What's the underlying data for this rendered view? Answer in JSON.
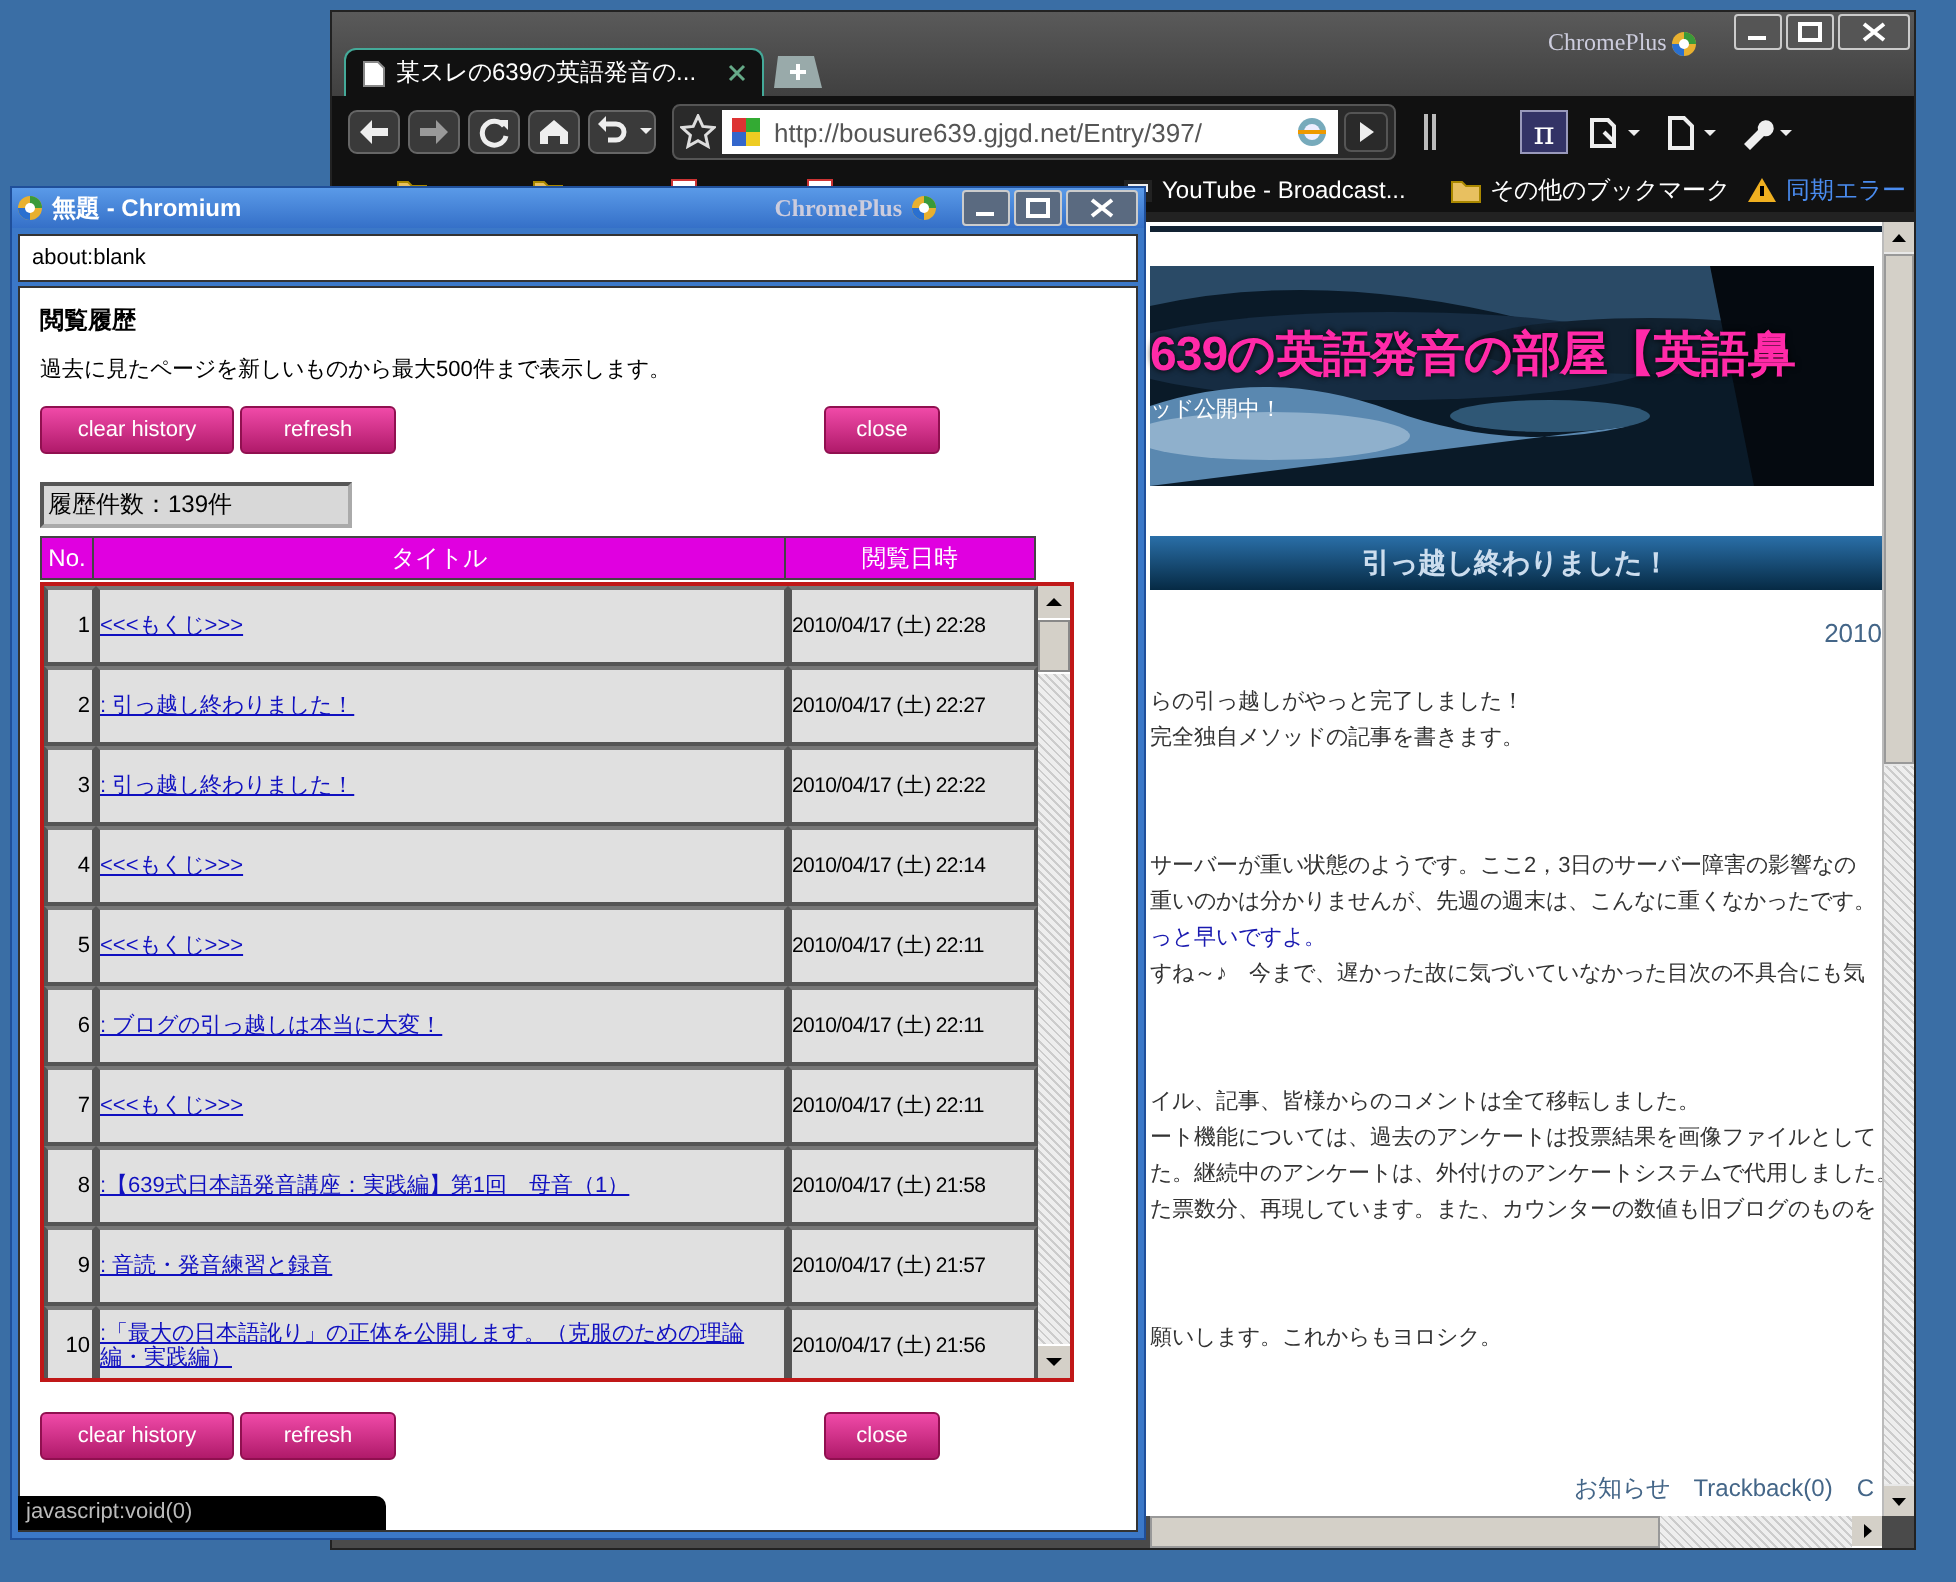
{
  "browser": {
    "tab_title": "某スレの639の英語発音の...",
    "brand": "ChromePlus",
    "address": "http://bousure639.gjgd.net/Entry/397/",
    "pi_button": "π",
    "bookmarks": [
      {
        "kind": "folder"
      },
      {
        "kind": "folder"
      },
      {
        "kind": "page"
      },
      {
        "kind": "page"
      },
      {
        "kind": "video",
        "label": "YouTube - Broadcast..."
      }
    ],
    "other_bookmarks": "その他のブックマーク",
    "sync_error": "同期エラー",
    "page": {
      "banner_title": "639の英語発音の部屋【英語鼻",
      "banner_subtitle": "ッド公開中！",
      "post_title": "引っ越し終わりました！",
      "date": "2010",
      "paragraphs": [
        [
          {
            "kind": "text",
            "text": "らの引っ越しがやっと完了しました！"
          },
          {
            "kind": "text",
            "text": "完全独自メソッドの記事を書きます。"
          }
        ],
        [
          {
            "kind": "text",
            "text": "サーバーが重い状態のようです。ここ2，3日のサーバー障害の影響なの"
          },
          {
            "kind": "text",
            "text": "重いのかは分かりませんが、先週の週末は、こんなに重くなかったです。"
          },
          {
            "kind": "link",
            "text": "っと早いですよ。"
          },
          {
            "kind": "text",
            "text": "すね～♪　今まで、遅かった故に気づいていなかった目次の不具合にも気"
          }
        ],
        [
          {
            "kind": "text",
            "text": "イル、記事、皆様からのコメントは全て移転しました。"
          },
          {
            "kind": "text",
            "text": "ート機能については、過去のアンケートは投票結果を画像ファイルとして"
          },
          {
            "kind": "text",
            "text": "た。継続中のアンケートは、外付けのアンケートシステムで代用しました。"
          },
          {
            "kind": "text",
            "text": "た票数分、再現しています。また、カウンターの数値も旧ブログのものを"
          }
        ],
        [
          {
            "kind": "text",
            "text": "願いします。これからもヨロシク。"
          }
        ]
      ],
      "footer": "お知らせ　Trackback(0)　C"
    }
  },
  "popup": {
    "title": "無題 - Chromium",
    "brand": "ChromePlus",
    "address": "about:blank",
    "heading": "閲覧履歴",
    "description": "過去に見たページを新しいものから最大500件まで表示します。",
    "buttons": [
      "clear history",
      "refresh",
      "close"
    ],
    "count": "履歴件数：139件",
    "columns": [
      "No.",
      "タイトル",
      "閲覧日時"
    ],
    "rows": [
      {
        "no": "1",
        "title": "<<<もくじ>>>",
        "time": "2010/04/17 (土) 22:28"
      },
      {
        "no": "2",
        "title": ": 引っ越し終わりました！",
        "time": "2010/04/17 (土) 22:27"
      },
      {
        "no": "3",
        "title": ": 引っ越し終わりました！",
        "time": "2010/04/17 (土) 22:22"
      },
      {
        "no": "4",
        "title": "<<<もくじ>>>",
        "time": "2010/04/17 (土) 22:14"
      },
      {
        "no": "5",
        "title": "<<<もくじ>>>",
        "time": "2010/04/17 (土) 22:11"
      },
      {
        "no": "6",
        "title": ": ブログの引っ越しは本当に大変！",
        "time": "2010/04/17 (土) 22:11"
      },
      {
        "no": "7",
        "title": "<<<もくじ>>>",
        "time": "2010/04/17 (土) 22:11"
      },
      {
        "no": "8",
        "title": ":【639式日本語発音講座：実践編】第1回　母音（1）",
        "time": "2010/04/17 (土) 21:58"
      },
      {
        "no": "9",
        "title": ": 音読・発音練習と録音",
        "time": "2010/04/17 (土) 21:57"
      },
      {
        "no": "10",
        "title": ":「最大の日本語訛り」の正体を公開します。（克服のための理論編・実践編）",
        "time": "2010/04/17 (土) 21:56"
      }
    ],
    "bottom_buttons": [
      "clear history",
      "refresh",
      "close"
    ],
    "status": "javascript:void(0)"
  }
}
